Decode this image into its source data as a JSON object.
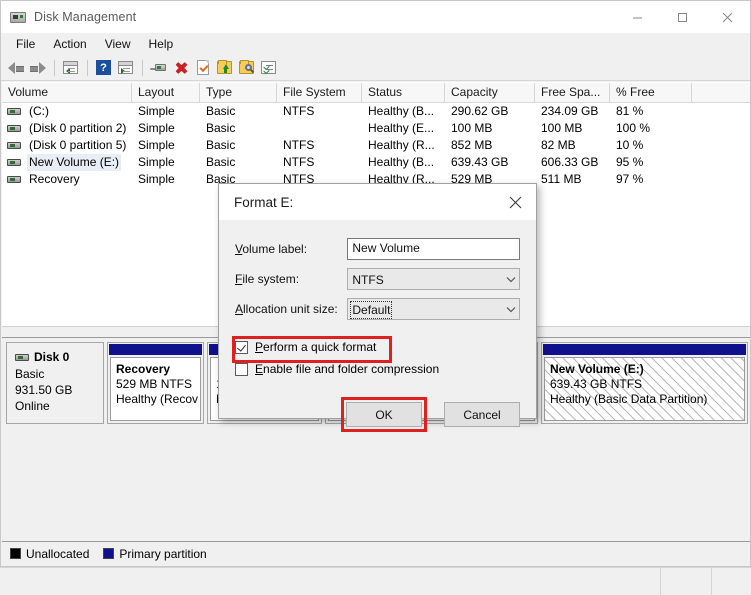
{
  "window": {
    "title": "Disk Management",
    "icon": "disk-icon",
    "controls": {
      "minimize": "minimize-icon",
      "maximize": "maximize-icon",
      "close": "close-icon"
    }
  },
  "menubar": {
    "items": [
      "File",
      "Action",
      "View",
      "Help"
    ]
  },
  "toolbar": {
    "items": [
      {
        "name": "back-icon",
        "label": "Back"
      },
      {
        "name": "forward-icon",
        "label": "Forward"
      },
      {
        "name": "show-hide-console-tree-icon",
        "label": "Show/Hide Console Tree"
      },
      {
        "name": "help-icon",
        "label": "Help"
      },
      {
        "name": "show-hide-action-pane-icon",
        "label": "Show/Hide Action Pane"
      },
      {
        "name": "rescan-disks-icon",
        "label": "Rescan Disks"
      },
      {
        "name": "delete-icon",
        "label": "Delete"
      },
      {
        "name": "properties-icon",
        "label": "Properties"
      },
      {
        "name": "export-list-icon",
        "label": "Export List"
      },
      {
        "name": "search-folder-icon",
        "label": "Search"
      },
      {
        "name": "detail-view-icon",
        "label": "Detail View"
      }
    ]
  },
  "volume_list": {
    "columns": [
      "Volume",
      "Layout",
      "Type",
      "File System",
      "Status",
      "Capacity",
      "Free Spa...",
      "% Free"
    ],
    "rows": [
      {
        "volume": "(C:)",
        "layout": "Simple",
        "type": "Basic",
        "fs": "NTFS",
        "status": "Healthy (B...",
        "capacity": "290.62 GB",
        "free": "234.09 GB",
        "pct": "81 %",
        "selected": false
      },
      {
        "volume": "(Disk 0 partition 2)",
        "layout": "Simple",
        "type": "Basic",
        "fs": "",
        "status": "Healthy (E...",
        "capacity": "100 MB",
        "free": "100 MB",
        "pct": "100 %",
        "selected": false
      },
      {
        "volume": "(Disk 0 partition 5)",
        "layout": "Simple",
        "type": "Basic",
        "fs": "NTFS",
        "status": "Healthy (R...",
        "capacity": "852 MB",
        "free": "82 MB",
        "pct": "10 %",
        "selected": false
      },
      {
        "volume": "New Volume (E:)",
        "layout": "Simple",
        "type": "Basic",
        "fs": "NTFS",
        "status": "Healthy (B...",
        "capacity": "639.43 GB",
        "free": "606.33 GB",
        "pct": "95 %",
        "selected": true
      },
      {
        "volume": "Recovery",
        "layout": "Simple",
        "type": "Basic",
        "fs": "NTFS",
        "status": "Healthy (R...",
        "capacity": "529 MB",
        "free": "511 MB",
        "pct": "97 %",
        "selected": false
      }
    ]
  },
  "disk_pane": {
    "disk": {
      "name": "Disk 0",
      "type": "Basic",
      "size": "931.50 GB",
      "state": "Online"
    },
    "partitions": [
      {
        "title": "Recovery",
        "line2": "529 MB NTFS",
        "line3": "Healthy (Recov",
        "hatched": false
      },
      {
        "title": "",
        "line2": "10",
        "line3": "H",
        "hatched": false
      },
      {
        "title": "",
        "line2": "",
        "line3": "",
        "hatched": false
      },
      {
        "title": "New Volume  (E:)",
        "line2": "639.43 GB NTFS",
        "line3": "Healthy (Basic Data Partition)",
        "hatched": true
      }
    ]
  },
  "legend": {
    "items": [
      {
        "label": "Unallocated",
        "color": "#000000"
      },
      {
        "label": "Primary partition",
        "color": "#10108c"
      }
    ]
  },
  "dialog": {
    "title": "Format E:",
    "close_icon": "close-icon",
    "fields": {
      "volume_label": {
        "label_prefix": "V",
        "label_rest": "olume label:",
        "value": "New Volume"
      },
      "file_system": {
        "label_prefix": "F",
        "label_rest": "ile system:",
        "value": "NTFS"
      },
      "allocation_unit": {
        "label_prefix": "A",
        "label_rest": "llocation unit size:",
        "value": "Default"
      }
    },
    "checkboxes": [
      {
        "prefix": "P",
        "rest": "erform a quick format",
        "checked": true,
        "highlighted": true
      },
      {
        "prefix": "E",
        "rest": "nable file and folder compression",
        "checked": false,
        "highlighted": false
      }
    ],
    "buttons": {
      "ok": "OK",
      "cancel": "Cancel"
    },
    "highlight_color": "#e02020"
  }
}
